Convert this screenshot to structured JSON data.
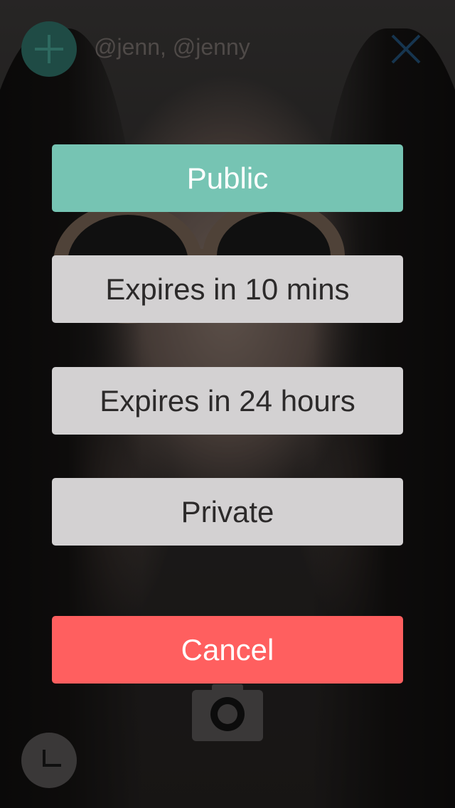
{
  "header": {
    "recipients": "@jenn, @jenny",
    "add_icon": "plus-icon",
    "close_icon": "close-icon"
  },
  "visibility_menu": {
    "options": [
      {
        "label": "Public"
      },
      {
        "label": "Expires in 10 mins"
      },
      {
        "label": "Expires in 24 hours"
      },
      {
        "label": "Private"
      }
    ],
    "cancel_label": "Cancel"
  },
  "footer": {
    "camera_icon": "camera-icon",
    "clock_icon": "clock-icon"
  },
  "colors": {
    "public": "#76c4b3",
    "option": "#d3d1d2",
    "cancel": "#ff5f5f",
    "accent_teal": "#1f4b45",
    "close_blue": "#16354f"
  }
}
